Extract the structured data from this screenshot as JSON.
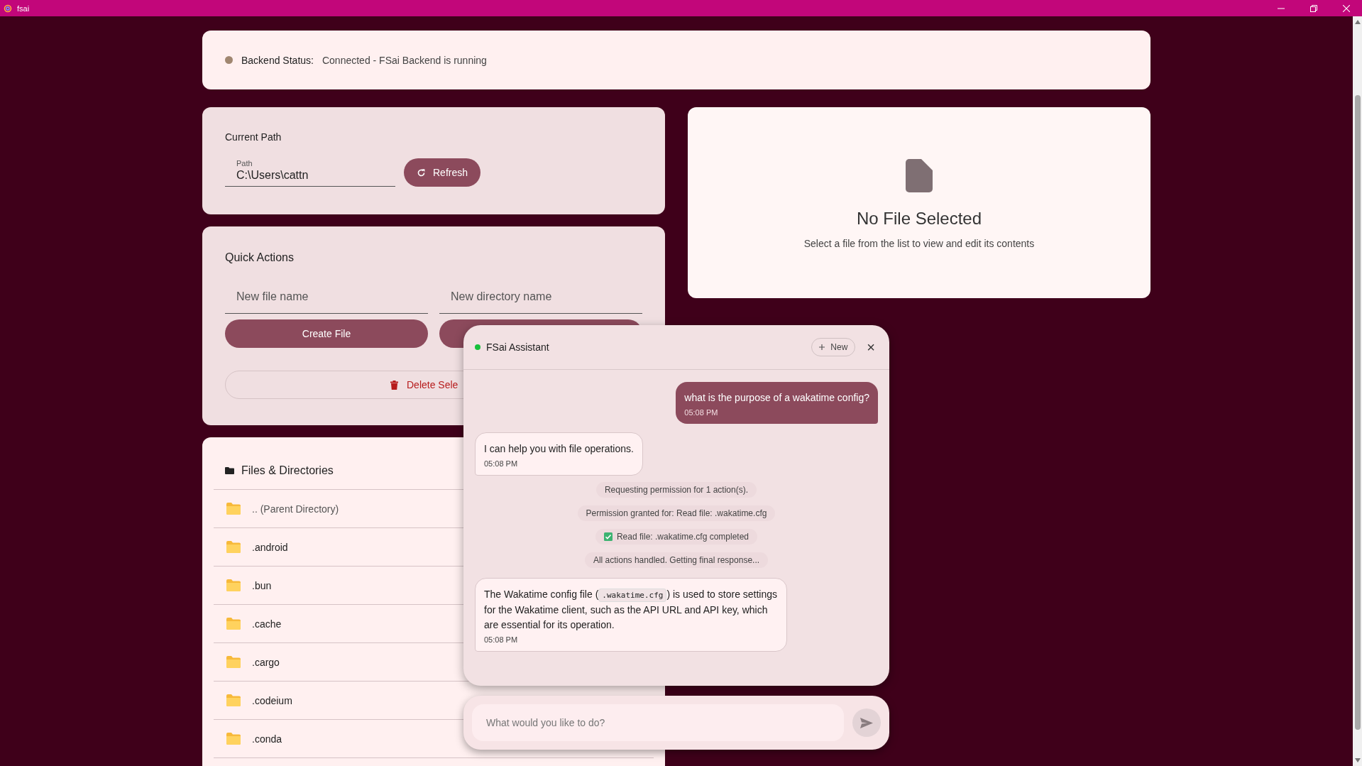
{
  "window": {
    "title": "fsai"
  },
  "backend_status": {
    "label": "Backend Status:",
    "value": "Connected - FSai Backend is running"
  },
  "current_path": {
    "title": "Current Path",
    "field_label": "Path",
    "value": "C:\\Users\\cattn",
    "refresh_button": "Refresh"
  },
  "quick_actions": {
    "title": "Quick Actions",
    "file_placeholder": "New file name",
    "directory_placeholder": "New directory name",
    "create_file_button": "Create File",
    "delete_button": "Delete Sele"
  },
  "files": {
    "title": "Files & Directories",
    "rows": [
      {
        "kind": "parent",
        "name": ".. (Parent Directory)"
      },
      {
        "kind": "folder",
        "name": ".android"
      },
      {
        "kind": "folder",
        "name": ".bun"
      },
      {
        "kind": "folder",
        "name": ".cache"
      },
      {
        "kind": "folder",
        "name": ".cargo"
      },
      {
        "kind": "folder",
        "name": ".codeium"
      },
      {
        "kind": "folder",
        "name": ".conda"
      }
    ]
  },
  "preview": {
    "title": "No File Selected",
    "hint": "Select a file from the list to view and edit its contents"
  },
  "assistant": {
    "title": "FSai Assistant",
    "online": true,
    "new_button": "New",
    "close_button": "×",
    "messages": [
      {
        "kind": "user",
        "parts": [
          {
            "kind": "text",
            "text": "what is the purpose of a wakatime config?"
          }
        ],
        "time": "05:08 PM"
      },
      {
        "kind": "assistant",
        "parts": [
          {
            "kind": "text",
            "text": "I can help you with file operations."
          }
        ],
        "time": "05:08 PM"
      },
      {
        "kind": "status",
        "completed": false,
        "text": "Requesting permission for 1 action(s)."
      },
      {
        "kind": "status",
        "completed": false,
        "text": "Permission granted for: Read file: .wakatime.cfg"
      },
      {
        "kind": "status",
        "completed": true,
        "text": "Read file: .wakatime.cfg completed"
      },
      {
        "kind": "status",
        "completed": false,
        "text": "All actions handled. Getting final response..."
      },
      {
        "kind": "assistant",
        "parts": [
          {
            "kind": "text",
            "text": "The Wakatime config file ("
          },
          {
            "kind": "code",
            "text": ".wakatime.cfg"
          },
          {
            "kind": "text",
            "text": ") is used to store settings for the Wakatime client, such as the API URL and API key, which are essential for its operation."
          }
        ],
        "time": "05:08 PM"
      }
    ],
    "input_placeholder": "What would you like to do?"
  }
}
